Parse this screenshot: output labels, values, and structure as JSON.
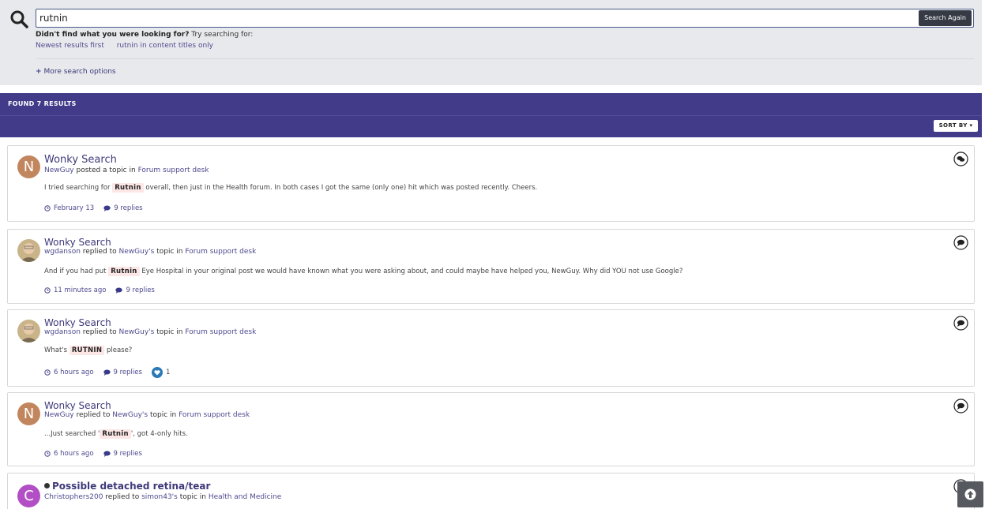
{
  "search": {
    "query": "rutnin",
    "button_label": "Search Again",
    "suggest_bold": "Didn't find what you were looking for?",
    "suggest_rest": " Try searching for:",
    "suggestions": [
      "Newest results first",
      "rutnin in content titles only"
    ],
    "more_options": "More search options"
  },
  "results_header": {
    "title": "FOUND 7 RESULTS",
    "sort_label": "SORT BY"
  },
  "results": [
    {
      "title": "Wonky Search",
      "author": "NewGuy",
      "action": " posted a topic in ",
      "topic_owner": "",
      "forum": "Forum support desk",
      "snippet_before": "I tried searching for ",
      "highlight": "Rutnin",
      "snippet_after": " overall, then just in the Health forum. In both cases I got the same (only one) hit which was posted recently. Cheers.",
      "time": "February 13",
      "replies": "9 replies",
      "avatar_letter": "N",
      "avatar_color": "#c2865e",
      "icon": "comments-icon"
    },
    {
      "title": "Wonky Search",
      "author": "wgdanson",
      "action": " replied to ",
      "topic_owner": "NewGuy's",
      "forum": "Forum support desk",
      "snippet_before": "And if you had put ",
      "highlight": "Rutnin",
      "snippet_after": " Eye Hospital in your original post we would have known what you were asking about, and could maybe have helped you, NewGuy. Why did YOU not use Google?",
      "time": "11 minutes ago",
      "replies": "9 replies",
      "avatar_letter": "",
      "avatar_color": "#b89a6a",
      "icon": "comment-icon"
    },
    {
      "title": "Wonky Search",
      "author": "wgdanson",
      "action": " replied to ",
      "topic_owner": "NewGuy's",
      "forum": "Forum support desk",
      "snippet_before": "What's ",
      "highlight": "RUTNIN",
      "snippet_after": " please?",
      "time": "6 hours ago",
      "replies": "9 replies",
      "likes": "1",
      "avatar_letter": "",
      "avatar_color": "#b89a6a",
      "icon": "comment-icon"
    },
    {
      "title": "Wonky Search",
      "author": "NewGuy",
      "action": " replied to ",
      "topic_owner": "NewGuy's",
      "forum": "Forum support desk",
      "snippet_before": "...Just searched '",
      "highlight": "Rutnin",
      "snippet_after": "', got 4-only hits.",
      "time": "6 hours ago",
      "replies": "9 replies",
      "avatar_letter": "N",
      "avatar_color": "#c2865e",
      "icon": "comment-icon"
    },
    {
      "title": "Possible detached retina/tear",
      "author": "Christophers200",
      "action": " replied to ",
      "topic_owner": "simon43's",
      "forum": "Health and Medicine",
      "avatar_letter": "C",
      "avatar_color": "#b24fc5",
      "icon": "comment-icon"
    }
  ],
  "colors": {
    "header_bar": "#413b8a",
    "link": "#4e4a8f",
    "highlight_bg": "#fde6e6"
  }
}
